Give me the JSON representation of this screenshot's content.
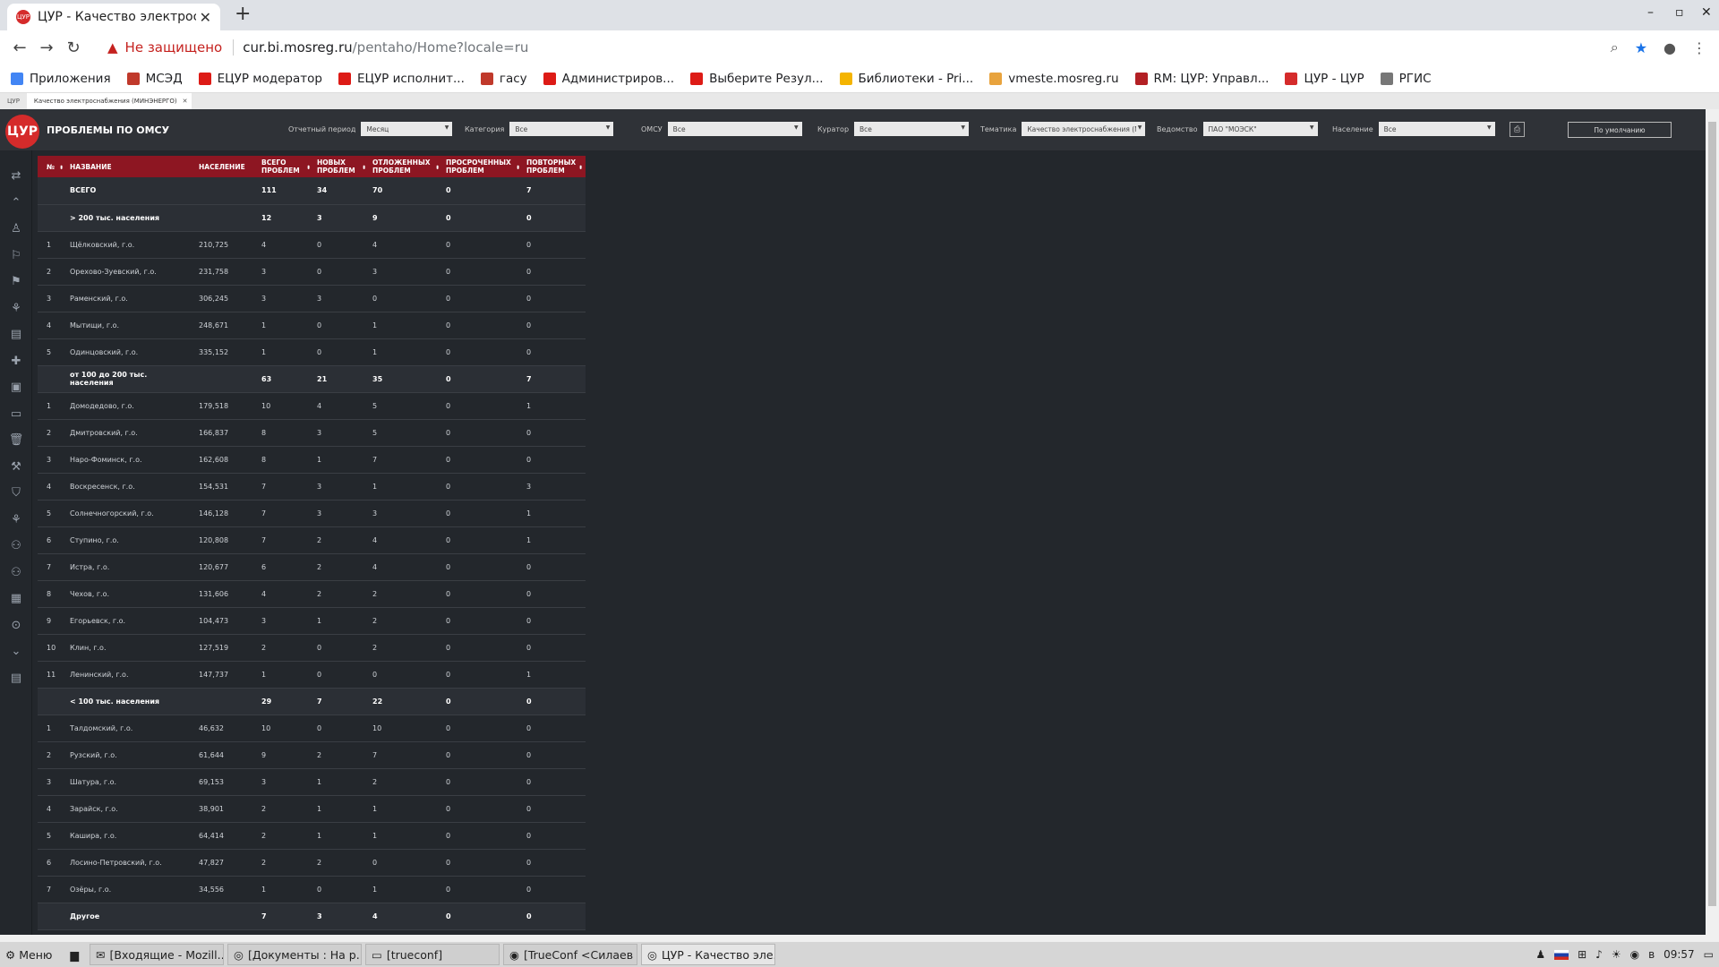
{
  "browser": {
    "tab_title": "ЦУР - Качество электросна",
    "tab_favicon": "ЦУР",
    "security_text": "Не защищено",
    "url_host": "cur.bi.mosreg.ru",
    "url_path": "/pentaho/Home?locale=ru"
  },
  "bookmarks": [
    {
      "label": "Приложения",
      "icon": "apps-icon",
      "color": "#4285f4"
    },
    {
      "label": "МСЭД",
      "icon": "building-icon",
      "color": "#c0392b"
    },
    {
      "label": "ЕЦУР модератор",
      "icon": "angular-icon",
      "color": "#dd1b16"
    },
    {
      "label": "ЕЦУР исполнит...",
      "icon": "angular-icon",
      "color": "#dd1b16"
    },
    {
      "label": "гасу",
      "icon": "building-icon",
      "color": "#c0392b"
    },
    {
      "label": "Администриров...",
      "icon": "angular-icon",
      "color": "#dd1b16"
    },
    {
      "label": "Выберите Резул...",
      "icon": "angular-icon",
      "color": "#dd1b16"
    },
    {
      "label": "Библиотеки - Pri...",
      "icon": "hand-icon",
      "color": "#f4b400"
    },
    {
      "label": "vmeste.mosreg.ru",
      "icon": "smile-icon",
      "color": "#e8a33d"
    },
    {
      "label": "RM: ЦУР: Управл...",
      "icon": "redmine-icon",
      "color": "#b32024"
    },
    {
      "label": "ЦУР - ЦУР",
      "icon": "cur-icon",
      "color": "#d52b2b"
    },
    {
      "label": "РГИС",
      "icon": "doc-icon",
      "color": "#777777"
    }
  ],
  "pentaho_tabs": [
    "ЦУР",
    "Качество электроснабжения (МИНЭНЕРГО)"
  ],
  "app": {
    "logo": "ЦУР",
    "title": "ПРОБЛЕМЫ ПО ОМСУ",
    "print_icon": "print-icon",
    "default_button": "По умолчанию"
  },
  "filters": [
    {
      "label": "Отчетный период",
      "value": "Месяц"
    },
    {
      "label": "Категория",
      "value": "Все"
    },
    {
      "label": "ОМСУ",
      "value": "Все"
    },
    {
      "label": "Куратор",
      "value": "Все"
    },
    {
      "label": "Тематика",
      "value": "Качество электроснабжения (М..."
    },
    {
      "label": "Ведомство",
      "value": "ПАО \"МОЭСК\""
    },
    {
      "label": "Население",
      "value": "Все"
    }
  ],
  "table": {
    "columns": [
      "№",
      "НАЗВАНИЕ",
      "НАСЕЛЕНИЕ",
      "ВСЕГО ПРОБЛЕМ",
      "НОВЫХ ПРОБЛЕМ",
      "ОТЛОЖЕННЫХ ПРОБЛЕМ",
      "ПРОСРОЧЕННЫХ ПРОБЛЕМ",
      "ПОВТОРНЫХ ПРОБЛЕМ"
    ],
    "rows": [
      [
        "",
        "ВСЕГО",
        "",
        "111",
        "34",
        "70",
        "0",
        "7"
      ],
      [
        "",
        "> 200 тыс. населения",
        "",
        "12",
        "3",
        "9",
        "0",
        "0"
      ],
      [
        "1",
        "Щёлковский, г.о.",
        "210,725",
        "4",
        "0",
        "4",
        "0",
        "0"
      ],
      [
        "2",
        "Орехово-Зуевский, г.о.",
        "231,758",
        "3",
        "0",
        "3",
        "0",
        "0"
      ],
      [
        "3",
        "Раменский, г.о.",
        "306,245",
        "3",
        "3",
        "0",
        "0",
        "0"
      ],
      [
        "4",
        "Мытищи, г.о.",
        "248,671",
        "1",
        "0",
        "1",
        "0",
        "0"
      ],
      [
        "5",
        "Одинцовский, г.о.",
        "335,152",
        "1",
        "0",
        "1",
        "0",
        "0"
      ],
      [
        "",
        "от 100 до 200 тыс. населения",
        "",
        "63",
        "21",
        "35",
        "0",
        "7"
      ],
      [
        "1",
        "Домодедово, г.о.",
        "179,518",
        "10",
        "4",
        "5",
        "0",
        "1"
      ],
      [
        "2",
        "Дмитровский, г.о.",
        "166,837",
        "8",
        "3",
        "5",
        "0",
        "0"
      ],
      [
        "3",
        "Наро-Фоминск, г.о.",
        "162,608",
        "8",
        "1",
        "7",
        "0",
        "0"
      ],
      [
        "4",
        "Воскресенск, г.о.",
        "154,531",
        "7",
        "3",
        "1",
        "0",
        "3"
      ],
      [
        "5",
        "Солнечногорский, г.о.",
        "146,128",
        "7",
        "3",
        "3",
        "0",
        "1"
      ],
      [
        "6",
        "Ступино, г.о.",
        "120,808",
        "7",
        "2",
        "4",
        "0",
        "1"
      ],
      [
        "7",
        "Истра, г.о.",
        "120,677",
        "6",
        "2",
        "4",
        "0",
        "0"
      ],
      [
        "8",
        "Чехов, г.о.",
        "131,606",
        "4",
        "2",
        "2",
        "0",
        "0"
      ],
      [
        "9",
        "Егорьевск, г.о.",
        "104,473",
        "3",
        "1",
        "2",
        "0",
        "0"
      ],
      [
        "10",
        "Клин, г.о.",
        "127,519",
        "2",
        "0",
        "2",
        "0",
        "0"
      ],
      [
        "11",
        "Ленинский, г.о.",
        "147,737",
        "1",
        "0",
        "0",
        "0",
        "1"
      ],
      [
        "",
        "< 100 тыс. населения",
        "",
        "29",
        "7",
        "22",
        "0",
        "0"
      ],
      [
        "1",
        "Талдомский, г.о.",
        "46,632",
        "10",
        "0",
        "10",
        "0",
        "0"
      ],
      [
        "2",
        "Рузский, г.о.",
        "61,644",
        "9",
        "2",
        "7",
        "0",
        "0"
      ],
      [
        "3",
        "Шатура, г.о.",
        "69,153",
        "3",
        "1",
        "2",
        "0",
        "0"
      ],
      [
        "4",
        "Зарайск, г.о.",
        "38,901",
        "2",
        "1",
        "1",
        "0",
        "0"
      ],
      [
        "5",
        "Кашира, г.о.",
        "64,414",
        "2",
        "1",
        "1",
        "0",
        "0"
      ],
      [
        "6",
        "Лосино-Петровский, г.о.",
        "47,827",
        "2",
        "2",
        "0",
        "0",
        "0"
      ],
      [
        "7",
        "Озёры, г.о.",
        "34,556",
        "1",
        "0",
        "1",
        "0",
        "0"
      ],
      [
        "",
        "Другое",
        "",
        "7",
        "3",
        "4",
        "0",
        "0"
      ]
    ]
  },
  "sidebar_icons": [
    "transfer-icon",
    "collapse-up-icon",
    "worker-icon",
    "road-icon",
    "flag-icon",
    "handshake-icon",
    "document-icon",
    "medical-icon",
    "book-icon",
    "bus-icon",
    "trash-icon",
    "crane-icon",
    "shield-icon",
    "hands-icon",
    "people-icon",
    "family-icon",
    "building-icon",
    "help-icon",
    "expand-down-icon",
    "save-icon"
  ],
  "taskbar": {
    "menu": "Меню",
    "apps": [
      {
        "label": "[Входящие - Mozill...",
        "icon": "thunderbird-icon"
      },
      {
        "label": "[Документы : На р...",
        "icon": "chrome-icon"
      },
      {
        "label": "[trueconf]",
        "icon": "folder-icon"
      },
      {
        "label": "[TrueConf <Силаев ...",
        "icon": "trueconf-icon"
      },
      {
        "label": "ЦУР - Качество эле...",
        "icon": "chrome-icon"
      }
    ],
    "clock": "09:57"
  }
}
